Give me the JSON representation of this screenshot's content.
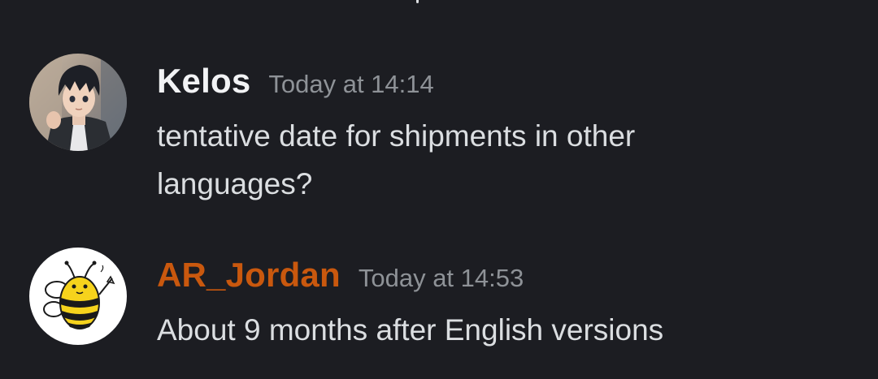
{
  "colors": {
    "background": "#1c1d22",
    "text": "#dbdee1",
    "timestamp": "#8e9297",
    "username_default": "#f2f3f5",
    "username_orange": "#c9580e"
  },
  "messages": [
    {
      "author": "Kelos",
      "author_color": "#f2f3f5",
      "timestamp": "Today at 14:14",
      "content": "tentative date for shipments in other\nlanguages?",
      "avatar": "anime-character-avatar"
    },
    {
      "author": "AR_Jordan",
      "author_color": "#c9580e",
      "timestamp": "Today at 14:53",
      "content": "About 9 months after English versions",
      "avatar": "bee-avatar"
    }
  ]
}
